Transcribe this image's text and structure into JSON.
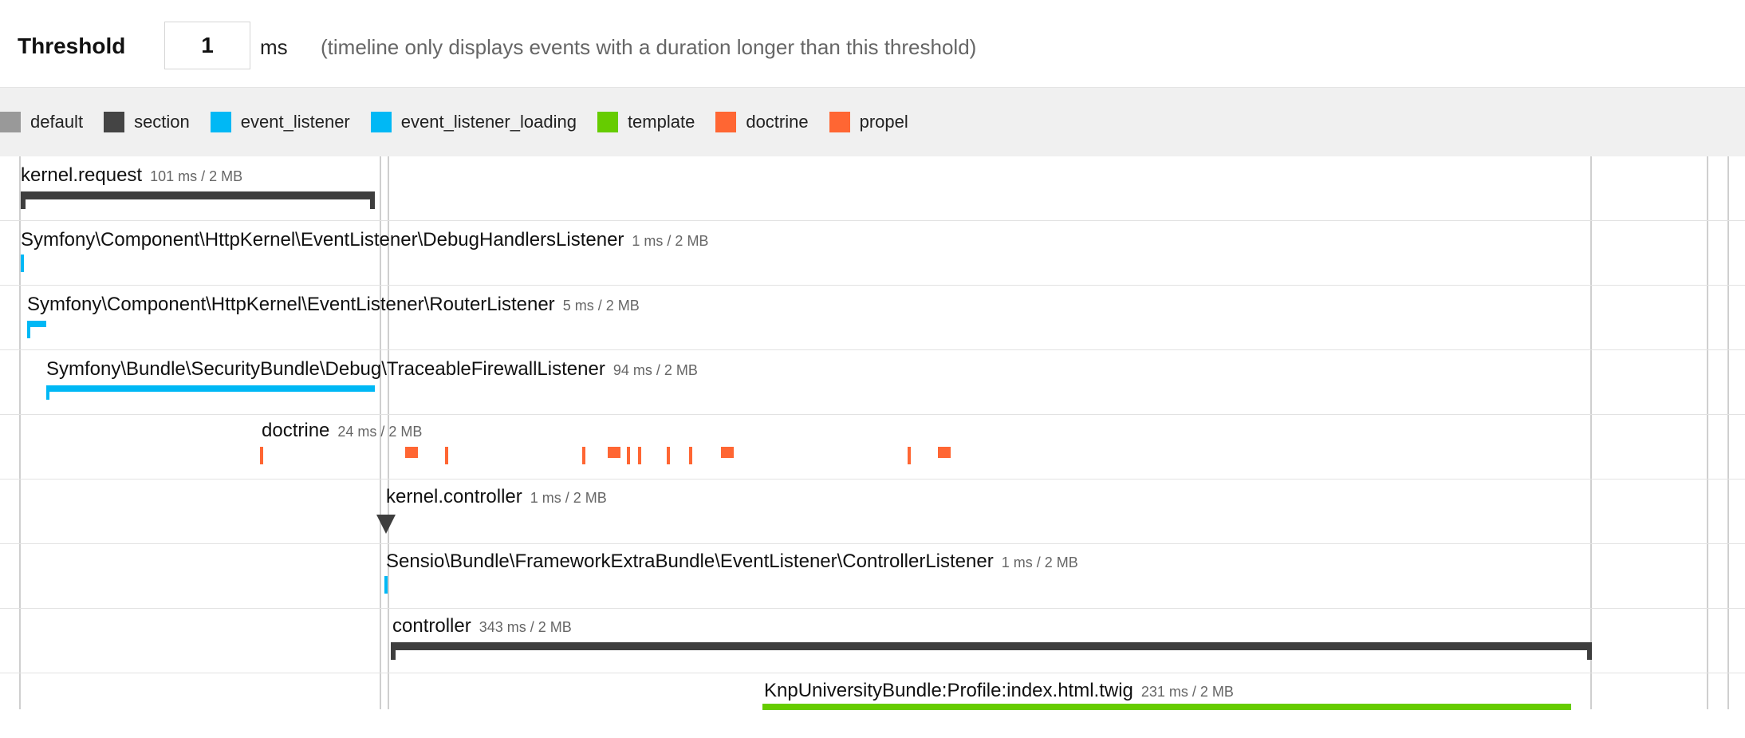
{
  "threshold": {
    "label": "Threshold",
    "value": "1",
    "unit": "ms",
    "hint": "(timeline only displays events with a duration longer than this threshold)"
  },
  "legend": [
    {
      "label": "default",
      "color": "#999999"
    },
    {
      "label": "section",
      "color": "#444444"
    },
    {
      "label": "event_listener",
      "color": "#00B8F5"
    },
    {
      "label": "event_listener_loading",
      "color": "#00B8F5"
    },
    {
      "label": "template",
      "color": "#66CC00"
    },
    {
      "label": "doctrine",
      "color": "#FF6633"
    },
    {
      "label": "propel",
      "color": "#FF6633"
    }
  ],
  "events": [
    {
      "name": "kernel.request",
      "meta": "101 ms / 2 MB"
    },
    {
      "name": "Symfony\\Component\\HttpKernel\\EventListener\\DebugHandlersListener",
      "meta": "1 ms / 2 MB"
    },
    {
      "name": "Symfony\\Component\\HttpKernel\\EventListener\\RouterListener",
      "meta": "5 ms / 2 MB"
    },
    {
      "name": "Symfony\\Bundle\\SecurityBundle\\Debug\\TraceableFirewallListener",
      "meta": "94 ms / 2 MB"
    },
    {
      "name": "doctrine",
      "meta": "24 ms / 2 MB"
    },
    {
      "name": "kernel.controller",
      "meta": "1 ms / 2 MB"
    },
    {
      "name": "Sensio\\Bundle\\FrameworkExtraBundle\\EventListener\\ControllerListener",
      "meta": "1 ms / 2 MB"
    },
    {
      "name": "controller",
      "meta": "343 ms / 2 MB"
    },
    {
      "name": "KnpUniversityBundle:Profile:index.html.twig",
      "meta": "231 ms / 2 MB"
    }
  ]
}
